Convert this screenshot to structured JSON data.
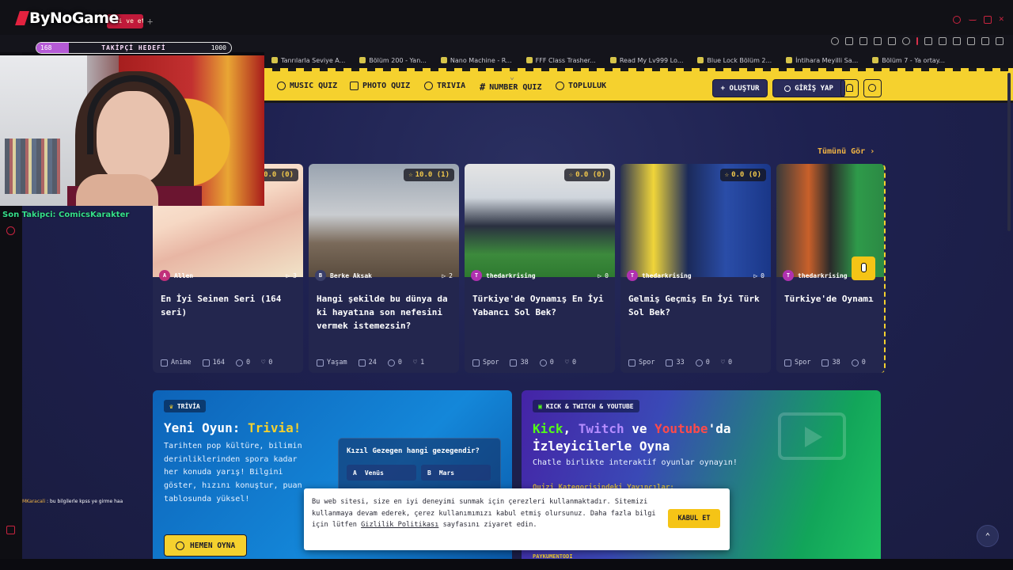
{
  "stream": {
    "logo": "ByNoGame",
    "follower_goal": {
      "current": "168",
      "label": "TAKİPÇİ HEDEFİ",
      "max": "1000",
      "progress": 0.168
    },
    "last_follower": "Son Takipci: ComicsKarakter",
    "chat": {
      "user": "MKaracali",
      "message": " : bu bilgilerle kpss ye girme haa"
    }
  },
  "browser": {
    "tab_title": "ali ve etkile",
    "bookmarks": [
      "Tanrılarla Seviye A...",
      "Bölüm 200 - Yan...",
      "Nano Machine - R...",
      "FFF Class Trasher...",
      "Read My Lv999 Lo...",
      "Blue Lock Bölüm 2...",
      "İntihara Meyilli Sa...",
      "Bölüm 7 - Ya ortay..."
    ]
  },
  "nav": {
    "items": [
      {
        "label": "MUSIC QUIZ",
        "icon": "music-icon"
      },
      {
        "label": "PHOTO QUIZ",
        "icon": "camera-icon"
      },
      {
        "label": "TRIVIA",
        "icon": "chat-question-icon"
      },
      {
        "label": "NUMBER QUIZ",
        "icon": "hash-icon"
      },
      {
        "label": "TOPLULUK",
        "icon": "users-icon"
      }
    ],
    "create_label": "+ OLUŞTUR",
    "login_label": "GİRİŞ YAP"
  },
  "section": {
    "see_all": "Tümünü Gör ›"
  },
  "cards": [
    {
      "rating": "0.0 (0)",
      "author": "Allen",
      "avatar_letter": "A",
      "avatar_color": "#c0307a",
      "plays": "3",
      "title": "En İyi Seinen Seri (164 seri)",
      "category": "Anime",
      "items": "164",
      "comments": "0",
      "likes": "0"
    },
    {
      "rating": "10.0 (1)",
      "author": "Berke Aksak",
      "avatar_letter": "B",
      "avatar_color": "#3a3f6a",
      "plays": "2",
      "title": "Hangi şekilde bu dünya da ki hayatına son nefesini vermek istemezsin?",
      "category": "Yaşam",
      "items": "24",
      "comments": "0",
      "likes": "1"
    },
    {
      "rating": "0.0 (0)",
      "author": "thedarkrising",
      "avatar_letter": "T",
      "avatar_color": "#b031b0",
      "plays": "0",
      "title": "Türkiye'de Oynamış En İyi Yabancı Sol Bek?",
      "category": "Spor",
      "items": "38",
      "comments": "0",
      "likes": "0"
    },
    {
      "rating": "0.0 (0)",
      "author": "thedarkrising",
      "avatar_letter": "T",
      "avatar_color": "#b031b0",
      "plays": "0",
      "title": "Gelmiş Geçmiş En İyi Türk Sol Bek?",
      "category": "Spor",
      "items": "33",
      "comments": "0",
      "likes": "0"
    },
    {
      "rating": "",
      "author": "thedarkrising",
      "avatar_letter": "T",
      "avatar_color": "#b031b0",
      "plays": "",
      "title": "Türkiye'de Oynamı İyi Yabancı Kaleci",
      "category": "Spor",
      "items": "38",
      "comments": "0",
      "likes": ""
    }
  ],
  "trivia": {
    "badge": "TRİVİA",
    "title_prefix": "Yeni Oyun: ",
    "title_highlight": "Trivia!",
    "description": "Tarihten pop kültüre, bilimin derinliklerinden spora kadar her konuda yarış! Bilgini göster, hızını konuştur, puan tablosunda yüksel!",
    "cta": "HEMEN OYNA",
    "sample_question": "Kızıl Gezegen hangi gezegendir?",
    "options": [
      {
        "key": "A",
        "label": "Venüs"
      },
      {
        "key": "B",
        "label": "Mars"
      }
    ]
  },
  "kick": {
    "badge": "KICK & TWITCH & YOUTUBE",
    "word_kick": "Kick",
    "sep1": ", ",
    "word_twitch": "Twitch",
    "sep2": " ve ",
    "word_youtube": "Youtube",
    "suffix": "'da",
    "line2": "İzleyicilerle Oyna",
    "description": "Chatle birlikte interaktif oyunlar oynayın!",
    "sub": "Quizi Kategorisindeki Yayıncılar:",
    "foot": "PAYKUMENTODI"
  },
  "cookie": {
    "text_before": "Bu web sitesi, size en iyi deneyimi sunmak için çerezleri kullanmaktadır. Sitemizi kullanmaya devam ederek, çerez kullanımımızı kabul etmiş olursunuz. Daha fazla bilgi için lütfen ",
    "link": "Gizlilik Politikası",
    "text_after": " sayfasını ziyaret edin.",
    "accept": "KABUL ET"
  },
  "colors": {
    "accent": "#f5d12e",
    "bg": "#1e2150",
    "card": "#23264e",
    "follower": "#35e08b"
  }
}
